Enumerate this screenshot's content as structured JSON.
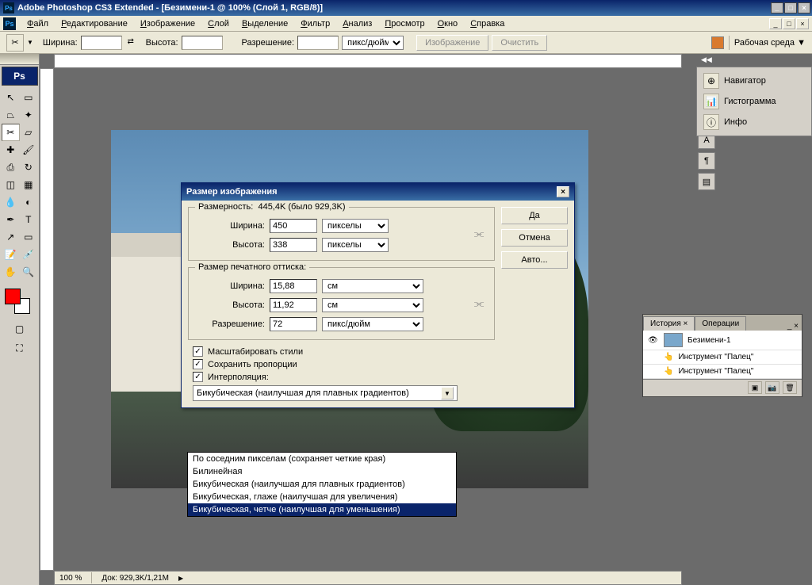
{
  "titlebar": {
    "app": "Adobe Photoshop CS3 Extended",
    "doc": "[Безимени-1 @ 100% (Слой 1, RGB/8)]"
  },
  "menu": {
    "items": [
      "Файл",
      "Редактирование",
      "Изображение",
      "Слой",
      "Выделение",
      "Фильтр",
      "Анализ",
      "Просмотр",
      "Окно",
      "Справка"
    ]
  },
  "options": {
    "width_label": "Ширина:",
    "height_label": "Высота:",
    "resolution_label": "Разрешение:",
    "unit": "пикс/дюйм",
    "image_btn": "Изображение",
    "clear_btn": "Очистить",
    "workspace": "Рабочая среда ▼"
  },
  "panels": {
    "nav": "Навигатор",
    "hist": "Гистограмма",
    "info": "Инфо"
  },
  "history": {
    "tab1": "История",
    "tab2": "Операции",
    "doc": "Безимени-1",
    "item": "Инструмент \"Палец\""
  },
  "status": {
    "zoom": "100 %",
    "doc": "Док: 929,3K/1,21M"
  },
  "dialog": {
    "title": "Размер изображения",
    "dimension_legend": "Размерность:",
    "dimension_value": "445,4K (было 929,3K)",
    "width_label": "Ширина:",
    "height_label": "Высота:",
    "resolution_label": "Разрешение:",
    "px_width": "450",
    "px_height": "338",
    "px_unit": "пикселы",
    "print_legend": "Размер печатного оттиска:",
    "print_width": "15,88",
    "print_height": "11,92",
    "print_unit": "см",
    "resolution": "72",
    "res_unit": "пикс/дюйм",
    "chk_scale": "Масштабировать стили",
    "chk_constrain": "Сохранить пропорции",
    "chk_resample": "Интерполяция:",
    "interp_selected": "Бикубическая (наилучшая для плавных градиентов)",
    "btn_ok": "Да",
    "btn_cancel": "Отмена",
    "btn_auto": "Авто..."
  },
  "dropdown": {
    "items": [
      "По соседним пикселам (сохраняет четкие края)",
      "Билинейная",
      "Бикубическая (наилучшая для плавных градиентов)",
      "Бикубическая, глаже (наилучшая для увеличения)",
      "Бикубическая, четче (наилучшая для уменьшения)"
    ],
    "selected_index": 4
  }
}
